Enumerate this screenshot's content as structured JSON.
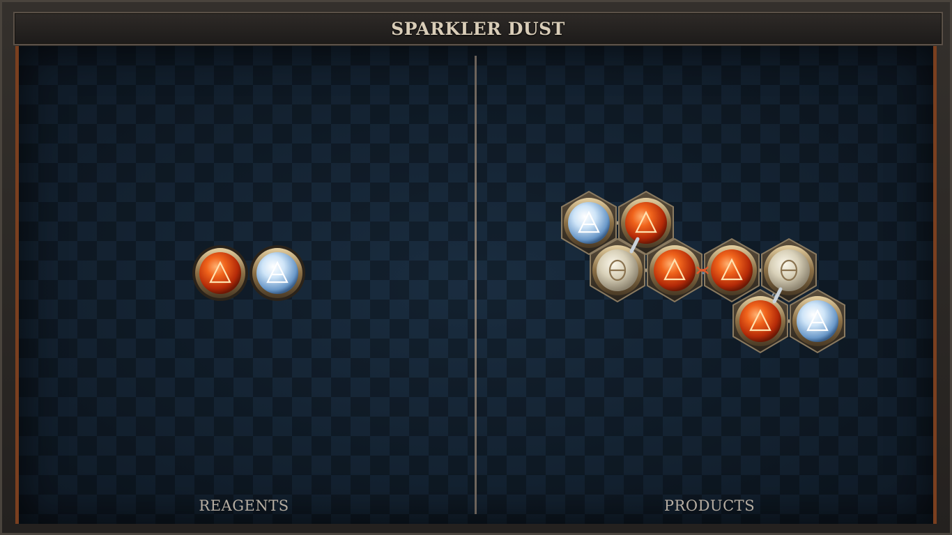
{
  "window": {
    "title": "SPARKLER DUST"
  },
  "reagents": {
    "label": "REAGENTS",
    "atoms": [
      {
        "element": "fire",
        "symbol": "🜂"
      },
      {
        "element": "air",
        "symbol": "🜁"
      }
    ]
  },
  "products": {
    "label": "PRODUCTS",
    "molecules": [
      {
        "atoms": [
          {
            "element": "air",
            "symbol": "🜁"
          },
          {
            "element": "fire",
            "symbol": "🜂"
          },
          {
            "element": "salt",
            "symbol": "θ"
          },
          {
            "element": "fire",
            "symbol": "🜂"
          }
        ]
      },
      {
        "atoms": [
          {
            "element": "fire",
            "symbol": "🜂"
          },
          {
            "element": "salt",
            "symbol": "θ"
          },
          {
            "element": "fire",
            "symbol": "🜂"
          },
          {
            "element": "air",
            "symbol": "🜁"
          }
        ]
      }
    ]
  },
  "colors": {
    "fire": "#d8420f",
    "air": "#b9d8f3",
    "salt": "#d9d2bd",
    "accent": "#7a3f1f"
  }
}
